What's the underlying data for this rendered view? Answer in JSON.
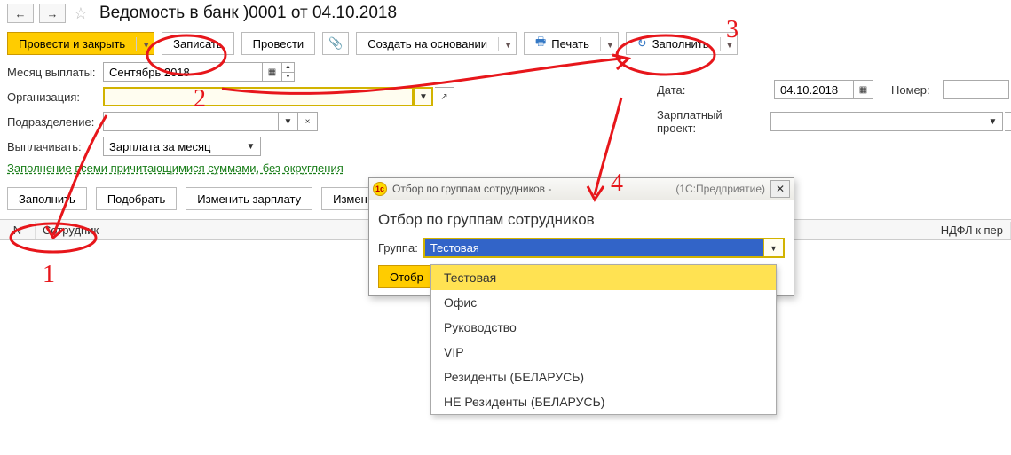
{
  "header": {
    "title": "Ведомость в банк        )0001 от 04.10.2018"
  },
  "toolbar": {
    "post_and_close": "Провести и закрыть",
    "save": "Записать",
    "post": "Провести",
    "create_on_basis": "Создать на основании",
    "print": "Печать",
    "fill": "Заполнить"
  },
  "form": {
    "month_label": "Месяц выплаты:",
    "month_value": "Сентябрь 2018",
    "org_label": "Организация:",
    "org_value": "",
    "subdiv_label": "Подразделение:",
    "subdiv_value": "",
    "pay_label": "Выплачивать:",
    "pay_value": "Зарплата за месяц",
    "date_label": "Дата:",
    "date_value": "04.10.2018",
    "number_label": "Номер:",
    "number_value": "",
    "project_label": "Зарплатный проект:",
    "project_value": "",
    "fill_info_link": "Заполнение всеми причитающимися суммами, без округления"
  },
  "actions": {
    "fill": "Заполнить",
    "pick": "Подобрать",
    "change_salary": "Изменить зарплату",
    "change": "Измен"
  },
  "table": {
    "col_n": "N",
    "col_emp": "Сотрудник",
    "col_ndfl": "НДФЛ к пер"
  },
  "modal": {
    "titlebar": "Отбор по группам сотрудников -",
    "platform": "(1С:Предприятие)",
    "heading": "Отбор по группам сотрудников",
    "group_label": "Группа:",
    "group_value": "Тестовая",
    "select_btn": "Отобр",
    "options": [
      "Тестовая",
      "Офис",
      "Руководство",
      "VIP",
      "Резиденты (БЕЛАРУСЬ)",
      "НЕ Резиденты (БЕЛАРУСЬ)"
    ]
  },
  "annotations": {
    "n1": "1",
    "n2": "2",
    "n3": "3",
    "n4": "4"
  }
}
